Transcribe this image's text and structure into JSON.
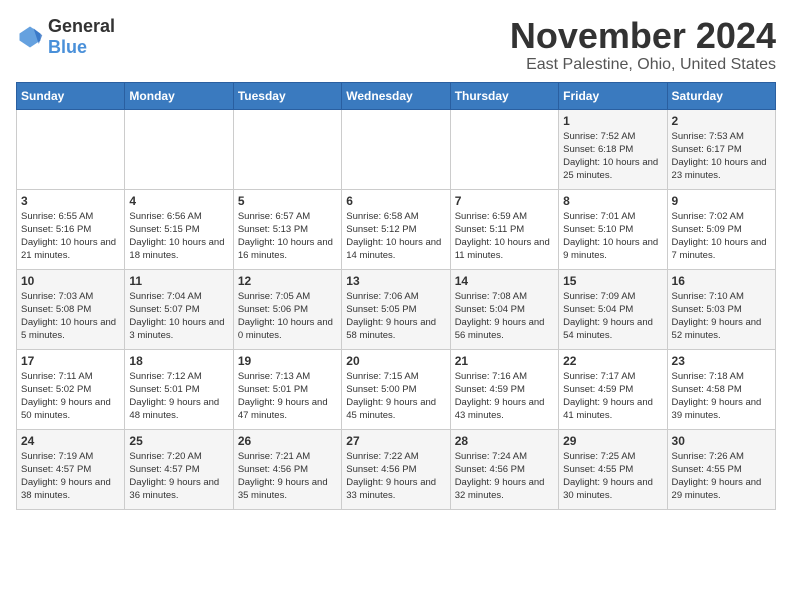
{
  "logo": {
    "general": "General",
    "blue": "Blue"
  },
  "title": "November 2024",
  "subtitle": "East Palestine, Ohio, United States",
  "days_of_week": [
    "Sunday",
    "Monday",
    "Tuesday",
    "Wednesday",
    "Thursday",
    "Friday",
    "Saturday"
  ],
  "weeks": [
    [
      {
        "day": "",
        "info": ""
      },
      {
        "day": "",
        "info": ""
      },
      {
        "day": "",
        "info": ""
      },
      {
        "day": "",
        "info": ""
      },
      {
        "day": "",
        "info": ""
      },
      {
        "day": "1",
        "info": "Sunrise: 7:52 AM\nSunset: 6:18 PM\nDaylight: 10 hours and 25 minutes."
      },
      {
        "day": "2",
        "info": "Sunrise: 7:53 AM\nSunset: 6:17 PM\nDaylight: 10 hours and 23 minutes."
      }
    ],
    [
      {
        "day": "3",
        "info": "Sunrise: 6:55 AM\nSunset: 5:16 PM\nDaylight: 10 hours and 21 minutes."
      },
      {
        "day": "4",
        "info": "Sunrise: 6:56 AM\nSunset: 5:15 PM\nDaylight: 10 hours and 18 minutes."
      },
      {
        "day": "5",
        "info": "Sunrise: 6:57 AM\nSunset: 5:13 PM\nDaylight: 10 hours and 16 minutes."
      },
      {
        "day": "6",
        "info": "Sunrise: 6:58 AM\nSunset: 5:12 PM\nDaylight: 10 hours and 14 minutes."
      },
      {
        "day": "7",
        "info": "Sunrise: 6:59 AM\nSunset: 5:11 PM\nDaylight: 10 hours and 11 minutes."
      },
      {
        "day": "8",
        "info": "Sunrise: 7:01 AM\nSunset: 5:10 PM\nDaylight: 10 hours and 9 minutes."
      },
      {
        "day": "9",
        "info": "Sunrise: 7:02 AM\nSunset: 5:09 PM\nDaylight: 10 hours and 7 minutes."
      }
    ],
    [
      {
        "day": "10",
        "info": "Sunrise: 7:03 AM\nSunset: 5:08 PM\nDaylight: 10 hours and 5 minutes."
      },
      {
        "day": "11",
        "info": "Sunrise: 7:04 AM\nSunset: 5:07 PM\nDaylight: 10 hours and 3 minutes."
      },
      {
        "day": "12",
        "info": "Sunrise: 7:05 AM\nSunset: 5:06 PM\nDaylight: 10 hours and 0 minutes."
      },
      {
        "day": "13",
        "info": "Sunrise: 7:06 AM\nSunset: 5:05 PM\nDaylight: 9 hours and 58 minutes."
      },
      {
        "day": "14",
        "info": "Sunrise: 7:08 AM\nSunset: 5:04 PM\nDaylight: 9 hours and 56 minutes."
      },
      {
        "day": "15",
        "info": "Sunrise: 7:09 AM\nSunset: 5:04 PM\nDaylight: 9 hours and 54 minutes."
      },
      {
        "day": "16",
        "info": "Sunrise: 7:10 AM\nSunset: 5:03 PM\nDaylight: 9 hours and 52 minutes."
      }
    ],
    [
      {
        "day": "17",
        "info": "Sunrise: 7:11 AM\nSunset: 5:02 PM\nDaylight: 9 hours and 50 minutes."
      },
      {
        "day": "18",
        "info": "Sunrise: 7:12 AM\nSunset: 5:01 PM\nDaylight: 9 hours and 48 minutes."
      },
      {
        "day": "19",
        "info": "Sunrise: 7:13 AM\nSunset: 5:01 PM\nDaylight: 9 hours and 47 minutes."
      },
      {
        "day": "20",
        "info": "Sunrise: 7:15 AM\nSunset: 5:00 PM\nDaylight: 9 hours and 45 minutes."
      },
      {
        "day": "21",
        "info": "Sunrise: 7:16 AM\nSunset: 4:59 PM\nDaylight: 9 hours and 43 minutes."
      },
      {
        "day": "22",
        "info": "Sunrise: 7:17 AM\nSunset: 4:59 PM\nDaylight: 9 hours and 41 minutes."
      },
      {
        "day": "23",
        "info": "Sunrise: 7:18 AM\nSunset: 4:58 PM\nDaylight: 9 hours and 39 minutes."
      }
    ],
    [
      {
        "day": "24",
        "info": "Sunrise: 7:19 AM\nSunset: 4:57 PM\nDaylight: 9 hours and 38 minutes."
      },
      {
        "day": "25",
        "info": "Sunrise: 7:20 AM\nSunset: 4:57 PM\nDaylight: 9 hours and 36 minutes."
      },
      {
        "day": "26",
        "info": "Sunrise: 7:21 AM\nSunset: 4:56 PM\nDaylight: 9 hours and 35 minutes."
      },
      {
        "day": "27",
        "info": "Sunrise: 7:22 AM\nSunset: 4:56 PM\nDaylight: 9 hours and 33 minutes."
      },
      {
        "day": "28",
        "info": "Sunrise: 7:24 AM\nSunset: 4:56 PM\nDaylight: 9 hours and 32 minutes."
      },
      {
        "day": "29",
        "info": "Sunrise: 7:25 AM\nSunset: 4:55 PM\nDaylight: 9 hours and 30 minutes."
      },
      {
        "day": "30",
        "info": "Sunrise: 7:26 AM\nSunset: 4:55 PM\nDaylight: 9 hours and 29 minutes."
      }
    ]
  ]
}
